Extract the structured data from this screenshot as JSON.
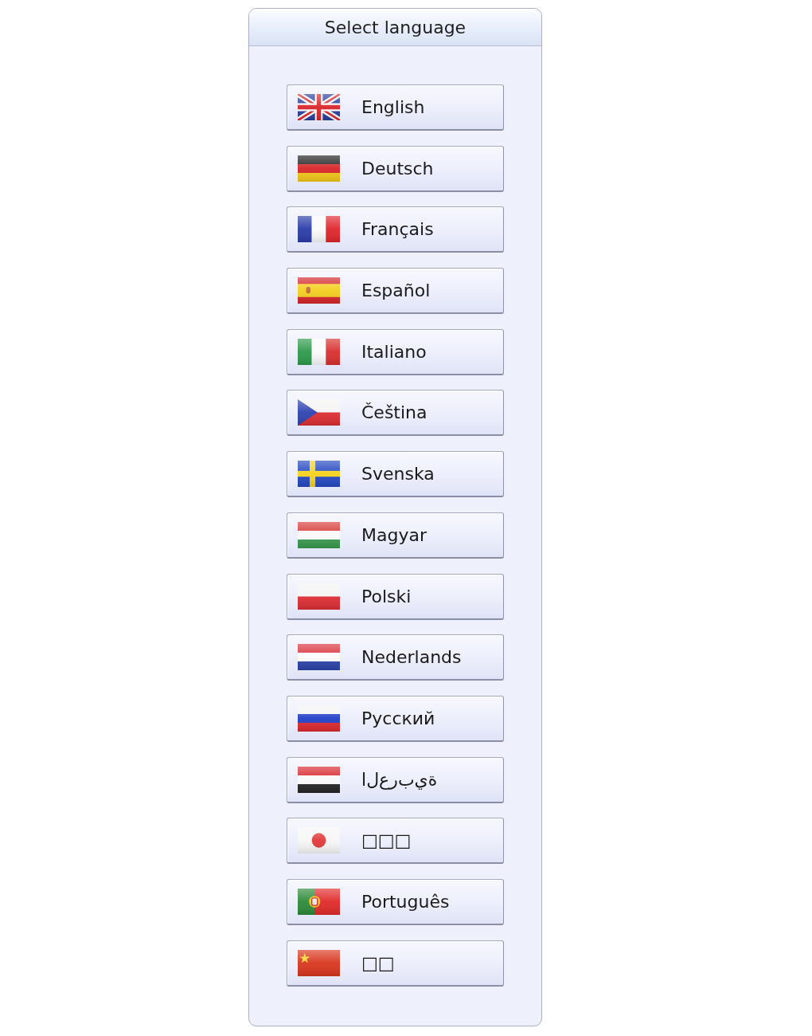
{
  "dialog": {
    "title": "Select language"
  },
  "languages": [
    {
      "label": "English",
      "kind": "britain"
    },
    {
      "label": "Deutsch",
      "kind": "germany"
    },
    {
      "label": "Français",
      "kind": "france"
    },
    {
      "label": "Español",
      "kind": "spain"
    },
    {
      "label": "Italiano",
      "kind": "italy"
    },
    {
      "label": "Čeština",
      "kind": "czechia"
    },
    {
      "label": "Svenska",
      "kind": "sweden"
    },
    {
      "label": "Magyar",
      "kind": "hungary"
    },
    {
      "label": "Polski",
      "kind": "poland"
    },
    {
      "label": "Nederlands",
      "kind": "netherlands"
    },
    {
      "label": "Русский",
      "kind": "russia"
    },
    {
      "label": "العربية",
      "kind": "yemen"
    },
    {
      "label": "□□□",
      "kind": "japan"
    },
    {
      "label": "Português",
      "kind": "portugal"
    },
    {
      "label": "□□",
      "kind": "china"
    }
  ]
}
